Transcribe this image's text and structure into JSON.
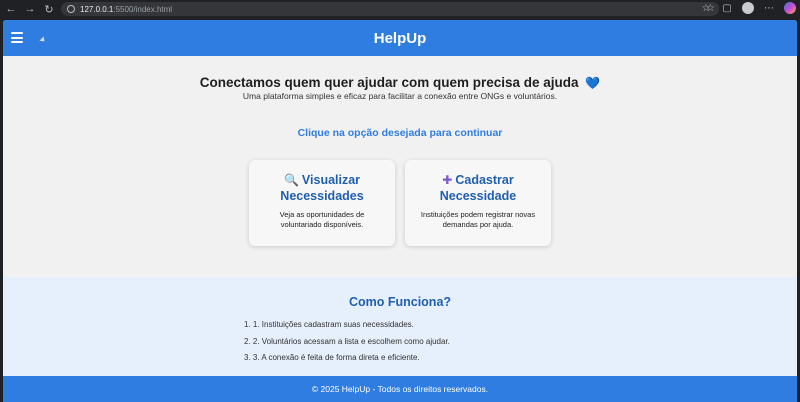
{
  "browser": {
    "url_host": "127.0.0.1",
    "url_rest": ":5500/index.html"
  },
  "header": {
    "title": "HelpUp"
  },
  "hero": {
    "heading": "Conectamos quem quer ajudar com quem precisa de ajuda",
    "heart": "💙",
    "subtitle": "Uma plataforma simples e eficaz para facilitar a conexão entre ONGs e voluntários."
  },
  "cta": "Clique na opção desejada para continuar",
  "cards": [
    {
      "icon": "🔍",
      "title_line1": "Visualizar",
      "title_line2": "Necessidades",
      "desc": "Veja as oportunidades de voluntariado disponíveis."
    },
    {
      "icon": "✚",
      "title_line1": "Cadastrar",
      "title_line2": "Necessidade",
      "desc": "Instituições podem registrar novas demandas por ajuda."
    }
  ],
  "how": {
    "title": "Como Funciona?",
    "steps": [
      "1. 1. Instituições cadastram suas necessidades.",
      "2. 2. Voluntários acessam a lista e escolhem como ajudar.",
      "3. 3. A conexão é feita de forma direta e eficiente."
    ]
  },
  "footer": {
    "text": "© 2025 HelpUp - Todos os direitos reservados."
  }
}
